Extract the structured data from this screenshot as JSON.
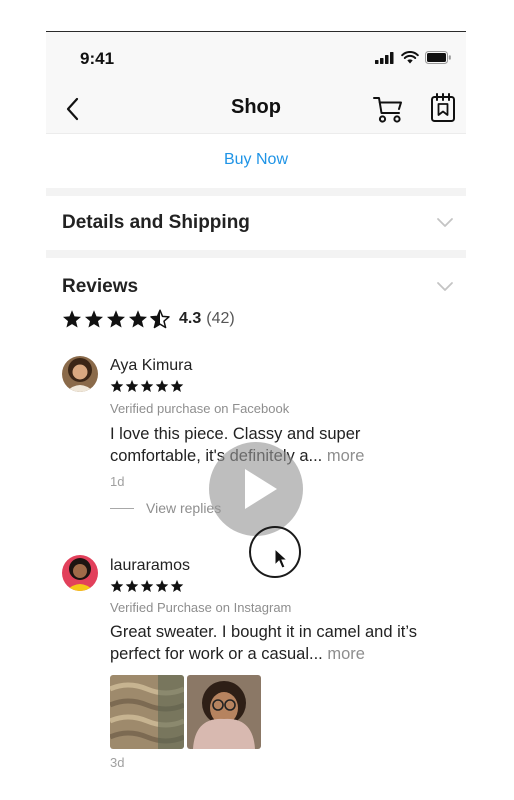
{
  "status_bar": {
    "time": "9:41"
  },
  "nav": {
    "title": "Shop"
  },
  "actions": {
    "buy_now": "Buy Now"
  },
  "sections": {
    "details_shipping": "Details and Shipping",
    "reviews": "Reviews"
  },
  "rating": {
    "value": "4.3",
    "count": "(42)",
    "stars": 4.5
  },
  "reviews": [
    {
      "name": "Aya Kimura",
      "stars": 5,
      "verified": "Verified purchase on Facebook",
      "text": "I love this piece. Classy and super comfortable, it's definitely a...",
      "more": "more",
      "age": "1d",
      "view_replies": "View replies"
    },
    {
      "name": "lauraramos",
      "stars": 5,
      "verified": "Verified Purchase on Instagram",
      "text": "Great sweater. I bought it in camel and it’s perfect for work or a casual...",
      "more": "more",
      "age": "3d"
    }
  ],
  "colors": {
    "accent": "#1f94e6",
    "text": "#222222",
    "muted": "#8e8e8e",
    "header_bg": "#f8f8f8"
  },
  "icons": {
    "back": "chevron-left-icon",
    "cart": "cart-icon",
    "saved": "bookmark-icon",
    "expand": "chevron-down-icon",
    "play": "play-icon",
    "cursor": "cursor-icon"
  }
}
